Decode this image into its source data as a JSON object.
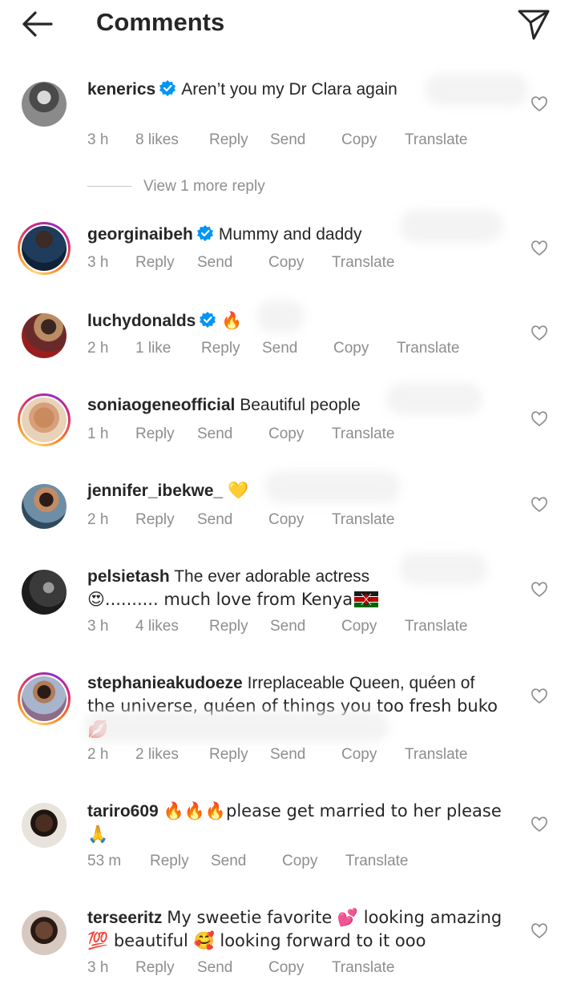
{
  "header": {
    "title": "Comments",
    "back_icon": "arrow-left-icon",
    "send_icon": "paper-plane-icon"
  },
  "colors": {
    "text": "#262626",
    "meta": "#8e8e8e",
    "verified": "#0095f6",
    "kenya_red": "#bb0000",
    "kenya_green": "#006600"
  },
  "comments": [
    {
      "username": "kenerics",
      "verified": true,
      "text": "Aren’t you my Dr Clara again",
      "time": "3 h",
      "likes": "8 likes",
      "actions": [
        "Reply",
        "Send",
        "Copy",
        "Translate"
      ]
    },
    {
      "username": "georginaibeh",
      "verified": true,
      "text": "Mummy and daddy",
      "time": "3 h",
      "actions": [
        "Reply",
        "Send",
        "Copy",
        "Translate"
      ]
    },
    {
      "username": "luchydonalds",
      "verified": true,
      "text": "🔥",
      "time": "2 h",
      "likes": "1 like",
      "actions": [
        "Reply",
        "Send",
        "Copy",
        "Translate"
      ]
    },
    {
      "username": "soniaogeneofficial",
      "verified": false,
      "text": "Beautiful people",
      "time": "1 h",
      "actions": [
        "Reply",
        "Send",
        "Copy",
        "Translate"
      ]
    },
    {
      "username": "jennifer_ibekwe_",
      "verified": false,
      "text": "💛",
      "time": "2 h",
      "actions": [
        "Reply",
        "Send",
        "Copy",
        "Translate"
      ]
    },
    {
      "username": "pelsietash",
      "verified": false,
      "text": "The ever adorable actress",
      "text2": "😍.......... much love from Kenya",
      "time": "3 h",
      "likes": "4 likes",
      "actions": [
        "Reply",
        "Send",
        "Copy",
        "Translate"
      ]
    },
    {
      "username": "stephanieakudoeze",
      "verified": false,
      "text": "Irreplaceable Queen, quéen of",
      "text2": "the universe, quéen of things you too fresh buko💋",
      "time": "2 h",
      "likes": "2 likes",
      "actions": [
        "Reply",
        "Send",
        "Copy",
        "Translate"
      ]
    },
    {
      "username": "tariro609",
      "verified": false,
      "text": "🔥🔥🔥please get married to her please",
      "text2": "🙏",
      "time": "53 m",
      "actions": [
        "Reply",
        "Send",
        "Copy",
        "Translate"
      ]
    },
    {
      "username": "terseeritz",
      "verified": false,
      "text": "My sweetie favorite 💕 looking amazing",
      "text2": "💯 beautiful 🥰 looking forward to it ooo",
      "time": "3 h",
      "actions": [
        "Reply",
        "Send",
        "Copy",
        "Translate"
      ]
    }
  ],
  "view_more": "View 1 more reply"
}
